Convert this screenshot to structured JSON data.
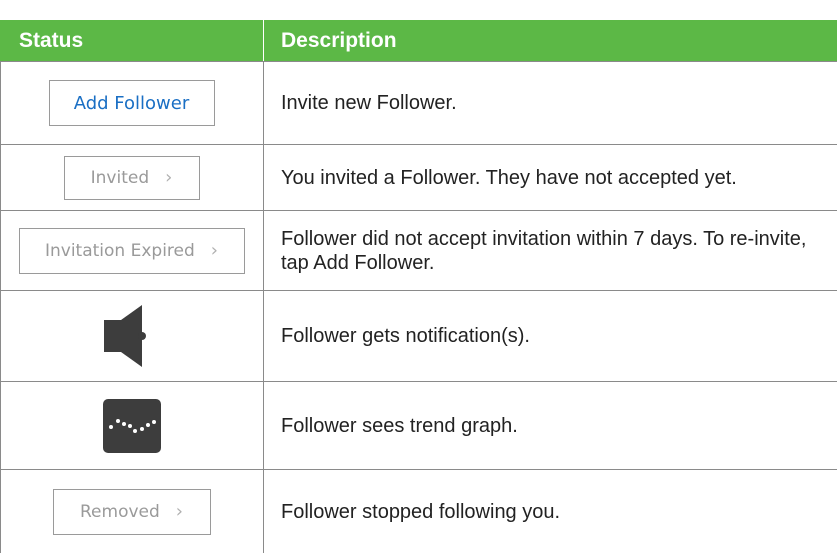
{
  "header": {
    "status_label": "Status",
    "description_label": "Description",
    "background_color": "#5cb846"
  },
  "rows": [
    {
      "status": {
        "kind": "button",
        "label": "Add Follower",
        "color": "#1a6fc4"
      },
      "description": "Invite new Follower."
    },
    {
      "status": {
        "kind": "button",
        "label": "Invited",
        "chevron": "›"
      },
      "description": "You invited a Follower. They have not accepted yet."
    },
    {
      "status": {
        "kind": "button",
        "label": "Invitation Expired",
        "chevron": "›"
      },
      "description": "Follower did not accept invitation within 7 days. To re-invite, tap Add Follower."
    },
    {
      "status": {
        "kind": "icon",
        "icon": "speaker-icon"
      },
      "description": "Follower gets notification(s)."
    },
    {
      "status": {
        "kind": "icon",
        "icon": "trend-graph-icon"
      },
      "description": "Follower sees trend graph."
    },
    {
      "status": {
        "kind": "button",
        "label": "Removed",
        "chevron": "›"
      },
      "description": "Follower stopped following you."
    }
  ]
}
